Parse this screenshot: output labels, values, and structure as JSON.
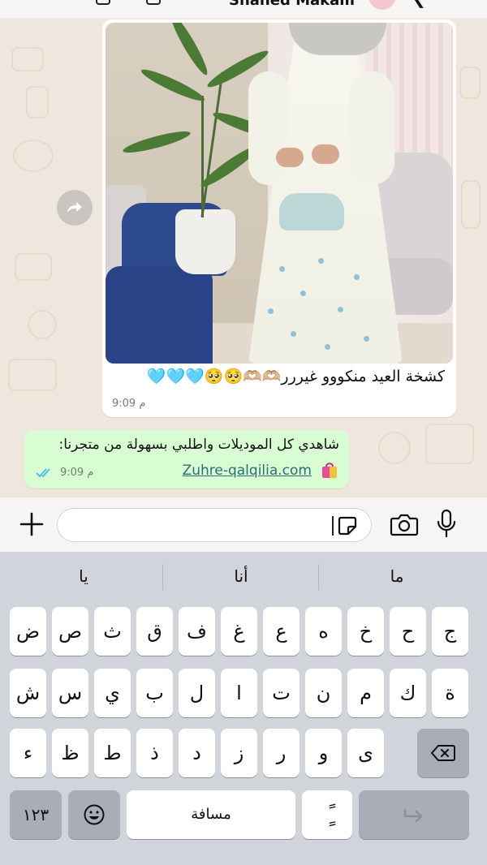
{
  "header": {
    "contact_name": "Shahed Makam"
  },
  "messages": {
    "incoming": {
      "caption": "كشخة العيد منكووو غيررر🫶🏼🫶🏼🥺🥺🩵🩵🩵",
      "time": "9:09 م"
    },
    "outgoing": {
      "line1": "شاهدي كل الموديلات واطلبي بسهولة من متجرنا:",
      "link": "Zuhre-qalqilia.com",
      "time": "9:09 م"
    }
  },
  "input": {
    "placeholder": ""
  },
  "keyboard": {
    "suggestions": [
      "يا",
      "أنا",
      "ما"
    ],
    "row1": [
      "ض",
      "ص",
      "ث",
      "ق",
      "ف",
      "غ",
      "ع",
      "ه",
      "خ",
      "ح",
      "ج"
    ],
    "row2": [
      "ش",
      "س",
      "ي",
      "ب",
      "ل",
      "ا",
      "ت",
      "ن",
      "م",
      "ك",
      "ة"
    ],
    "row3": [
      "ء",
      "ظ",
      "ط",
      "ذ",
      "د",
      "ز",
      "ر",
      "و",
      "ى"
    ],
    "numbers_label": "١٢٣",
    "space_label": "مسافة",
    "diacritic_label": "ًٍ"
  },
  "colors": {
    "chat_bg": "#efe7dd",
    "incoming_bubble": "#ffffff",
    "outgoing_bubble": "#d9fdd3",
    "link": "#2b6e77",
    "read_ticks": "#53bdeb",
    "keyboard_bg": "#d2d4db"
  },
  "icons": [
    "forward-icon",
    "plus-icon",
    "sticker-icon",
    "camera-icon",
    "microphone-icon",
    "backspace-icon",
    "emoji-icon",
    "return-icon",
    "shopping-bag-icon",
    "read-ticks-icon"
  ]
}
